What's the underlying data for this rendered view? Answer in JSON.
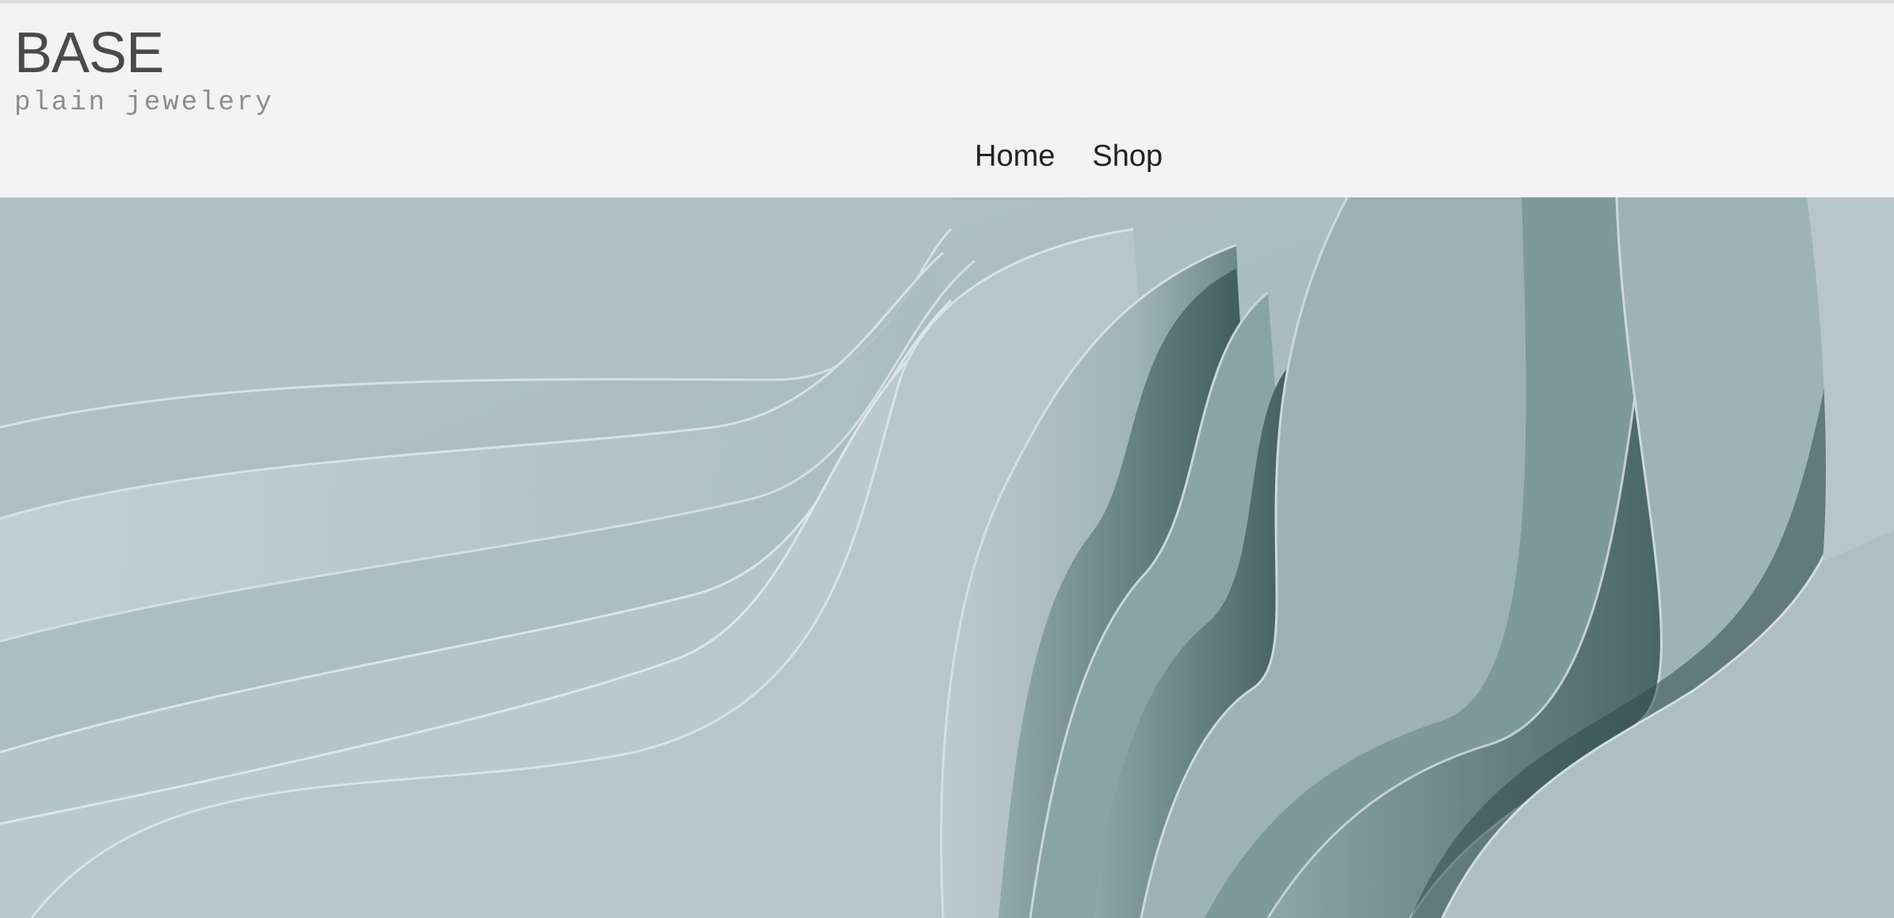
{
  "brand": {
    "title": "BASE",
    "tagline": "plain jewelery"
  },
  "nav": {
    "items": [
      {
        "label": "Home"
      },
      {
        "label": "Shop"
      }
    ]
  },
  "hero": {
    "image": "abstract-folded-fabric-image",
    "colors": {
      "light": "#c3d1d4",
      "mid": "#a9bcc0",
      "dark": "#5f7b7c",
      "shadow": "#2f4b4b"
    }
  }
}
